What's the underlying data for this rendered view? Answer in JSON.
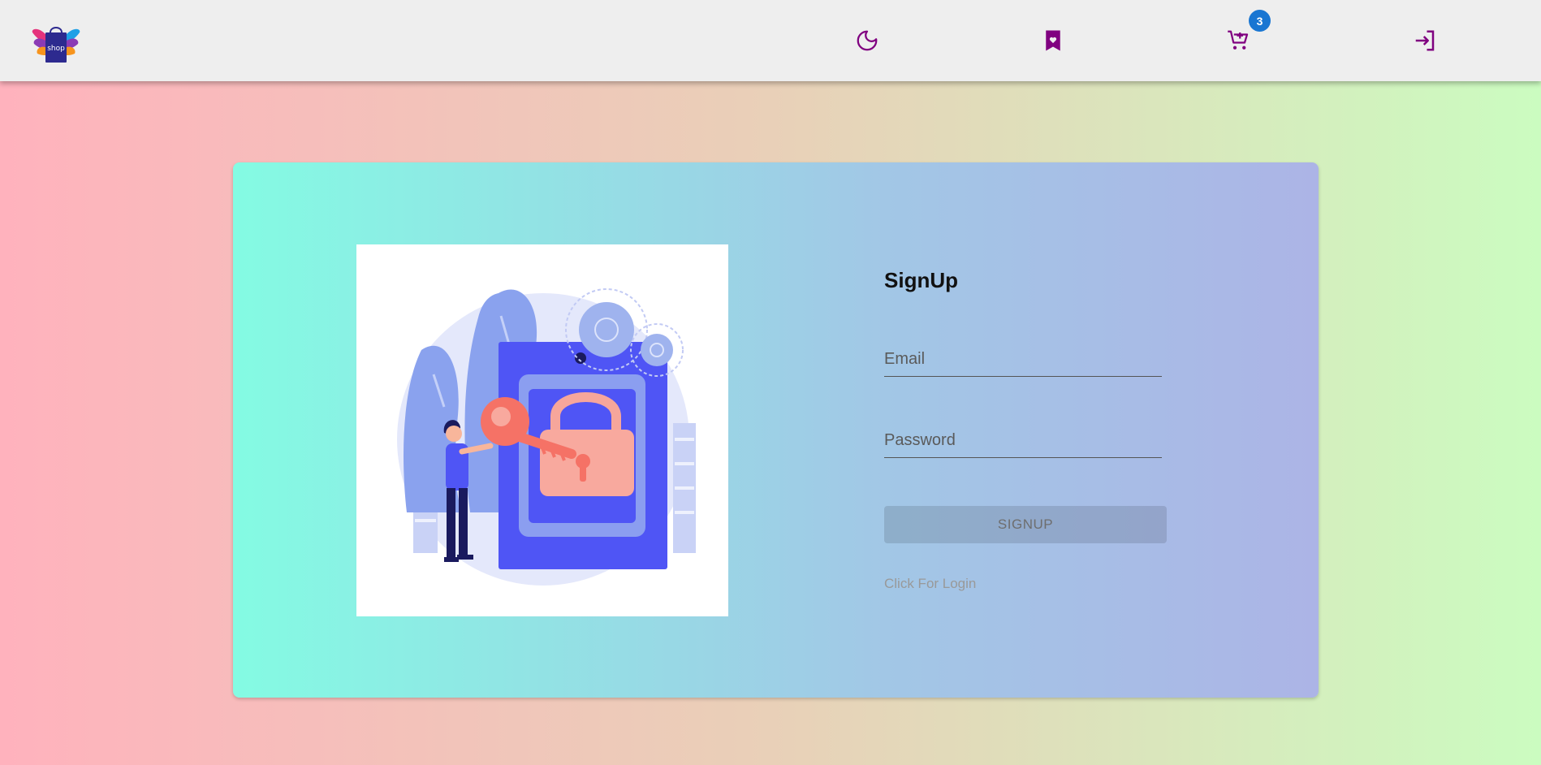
{
  "navbar": {
    "logo_text": "shop",
    "cart_badge": "3",
    "icons": {
      "theme": "moon-icon",
      "wishlist": "bookmark-heart-icon",
      "cart": "cart-add-icon",
      "login": "login-icon"
    },
    "icon_color": "#800080"
  },
  "signup": {
    "title": "SignUp",
    "email_placeholder": "Email",
    "password_placeholder": "Password",
    "button_label": "SIGNUP",
    "login_link": "Click For Login"
  },
  "colors": {
    "badge": "#1976d2",
    "illustration_primary": "#4f55f5",
    "illustration_accent": "#f57266"
  }
}
